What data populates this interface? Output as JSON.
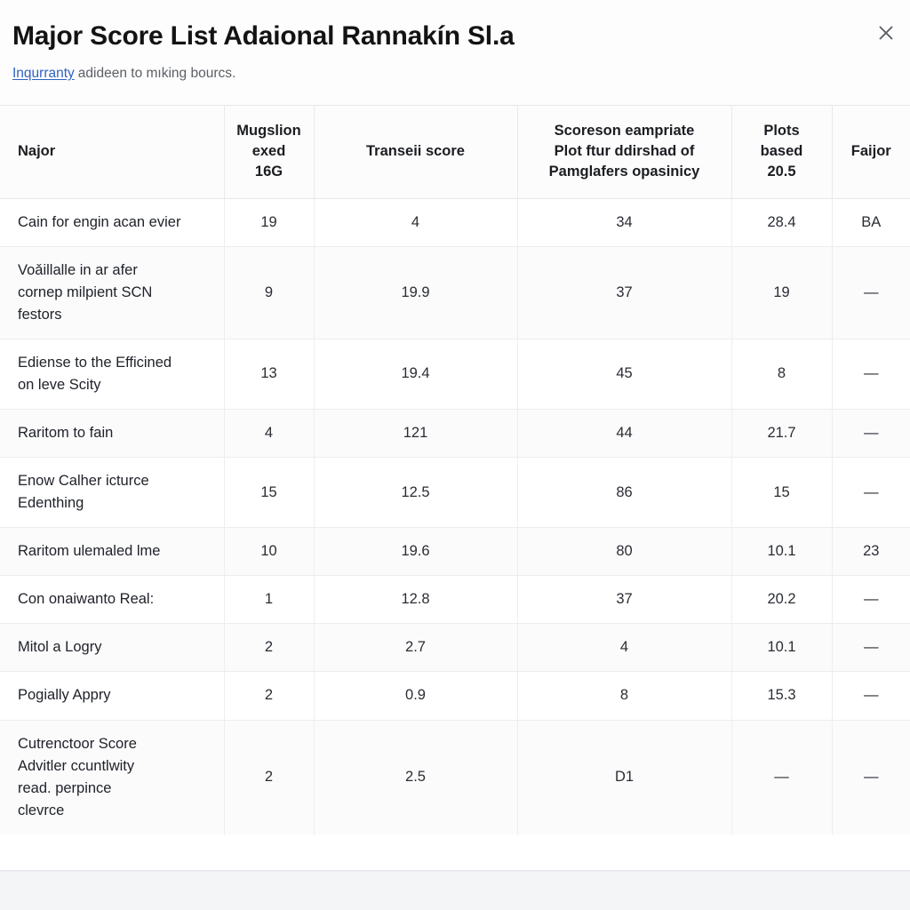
{
  "header": {
    "title": "Major Score List Adaional Rannakín Sl.a",
    "subtitle_link": "Inqurranty",
    "subtitle_rest": "adideen to mıking bourcs.",
    "close_label": "×"
  },
  "table": {
    "columns": [
      "Najor",
      "Mugslion exed 16G",
      "Transeii score",
      "Scoreson eampriate Plot ftur ddirshad of Pamglafers opasinicy",
      "Plots based 20.5",
      "Faijor"
    ],
    "column_lines": [
      [
        "Najor"
      ],
      [
        "Mugslion",
        "exed",
        "16G"
      ],
      [
        "Transeii score"
      ],
      [
        "Scoreson eampriate",
        "Plot ftur ddirshad of",
        "Pamglafers opasinicy"
      ],
      [
        "Plots",
        "based",
        "20.5"
      ],
      [
        "Faijor"
      ]
    ],
    "rows": [
      {
        "name": "Cain for engin acan evier",
        "name_lines": [
          "Cain for engin acan evier"
        ],
        "mugslion": "19",
        "transeii": "4",
        "scoreson": "34",
        "plots": "28.4",
        "faijor": "BA"
      },
      {
        "name": "Voǎillalle in ar afer cornep milpient SCN festors",
        "name_lines": [
          "Voǎillalle in ar afer",
          "cornep milpient SCN",
          "festors"
        ],
        "mugslion": "9",
        "transeii": "19.9",
        "scoreson": "37",
        "plots": "19",
        "faijor": "—"
      },
      {
        "name": "Ediense to the Efficined on leve Scity",
        "name_lines": [
          "Ediense to the Efficined",
          "on leve Scity"
        ],
        "mugslion": "13",
        "transeii": "19.4",
        "scoreson": "45",
        "plots": "8",
        "faijor": "—"
      },
      {
        "name": "Raritom to fain",
        "name_lines": [
          "Raritom to fain"
        ],
        "mugslion": "4",
        "transeii": "121",
        "scoreson": "44",
        "plots": "21.7",
        "faijor": "—"
      },
      {
        "name": "Enow Calher icturce Edenthing",
        "name_lines": [
          "Enow Calher icturce",
          "Edenthing"
        ],
        "mugslion": "15",
        "transeii": "12.5",
        "scoreson": "86",
        "plots": "15",
        "faijor": "—"
      },
      {
        "name": "Raritom ulemaled lme",
        "name_lines": [
          "Raritom ulemaled lme"
        ],
        "mugslion": "10",
        "transeii": "19.6",
        "scoreson": "80",
        "plots": "10.1",
        "faijor": "23"
      },
      {
        "name": "Con onaiwanto Real:",
        "name_lines": [
          "Con onaiwanto Real:"
        ],
        "mugslion": "1",
        "transeii": "12.8",
        "scoreson": "37",
        "plots": "20.2",
        "faijor": "—"
      },
      {
        "name": "Mitol a Logry",
        "name_lines": [
          "Mitol a Logry"
        ],
        "mugslion": "2",
        "transeii": "2.7",
        "scoreson": "4",
        "plots": "10.1",
        "faijor": "—"
      },
      {
        "name": "Pogially Appry",
        "name_lines": [
          "Pogially Appry"
        ],
        "mugslion": "2",
        "transeii": "0.9",
        "scoreson": "8",
        "plots": "15.3",
        "faijor": "—"
      },
      {
        "name": "Cutrenctoor Score Advitler ccuntlwity read. perpince clevrce",
        "name_lines": [
          "Cutrenctoor Score",
          "Advitler ccuntlwity",
          "read. perpince",
          "clevrce"
        ],
        "mugslion": "2",
        "transeii": "2.5",
        "scoreson": "D1",
        "plots": "—",
        "faijor": "—"
      }
    ]
  },
  "colors": {
    "link": "#2f62c4",
    "text": "#131313",
    "muted": "#5c6066",
    "border": "#e6e8eb",
    "card": "#ffffff",
    "page": "#fdfdfd",
    "strip": "#f4f5f7"
  }
}
